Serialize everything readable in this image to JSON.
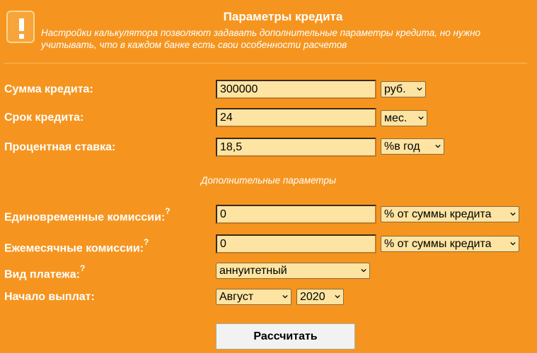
{
  "header": {
    "title": "Параметры кредита",
    "description": "Настройки калькулятора позволяют задавать дополнительные параметры кредита, но нужно учитывать, что в каждом банке есть свои особенности расчетов"
  },
  "fields": {
    "amount": {
      "label": "Сумма кредита:",
      "value": "300000",
      "unit": "руб."
    },
    "term": {
      "label": "Срок кредита:",
      "value": "24",
      "unit": "мес."
    },
    "rate": {
      "label": "Процентная ставка:",
      "value": "18,5",
      "unit": "%в год"
    }
  },
  "additional": {
    "header": "Дополнительные параметры",
    "one_time_fee": {
      "label": "Единовременные комиссии:",
      "help": "?",
      "value": "0",
      "unit": "% от суммы кредита"
    },
    "monthly_fee": {
      "label": "Ежемесячные комиссии:",
      "help": "?",
      "value": "0",
      "unit": "% от суммы кредита"
    },
    "payment_type": {
      "label": "Вид платежа:",
      "help": "?",
      "value": "аннуитетный"
    },
    "start": {
      "label": "Начало выплат:",
      "month": "Август",
      "year": "2020"
    }
  },
  "calculate_button": "Рассчитать"
}
